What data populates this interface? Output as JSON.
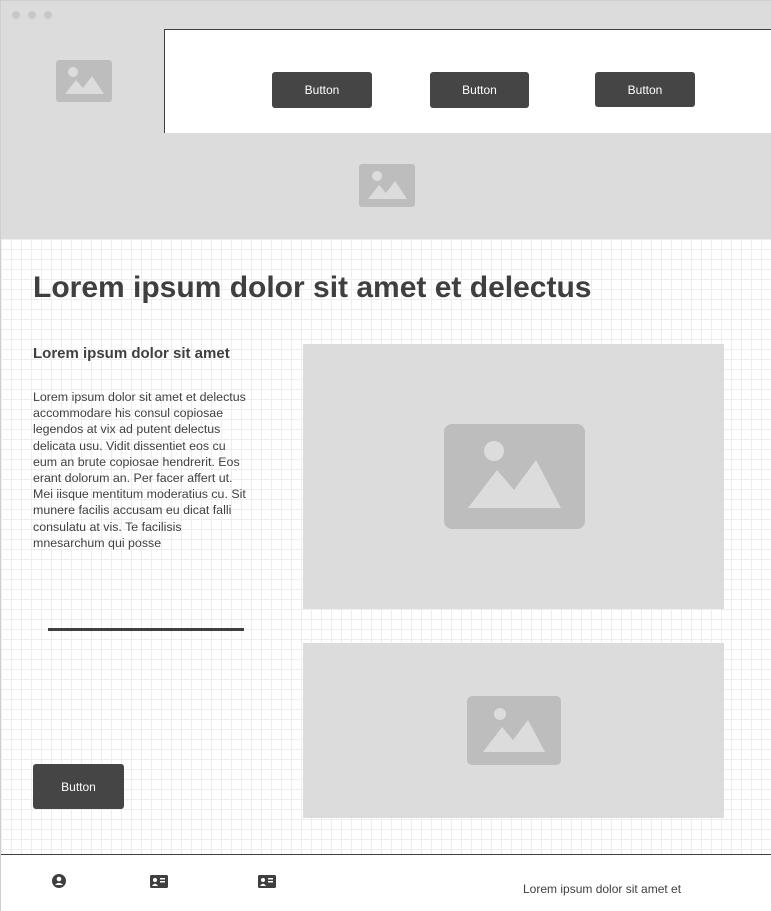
{
  "window": {
    "controls": [
      "dot",
      "dot",
      "dot"
    ]
  },
  "header": {
    "logo_icon": "image-placeholder-icon",
    "nav_buttons": [
      "Button",
      "Button",
      "Button"
    ]
  },
  "hero": {
    "icon": "image-placeholder-icon"
  },
  "main": {
    "headline": "Lorem ipsum dolor sit amet et delectus",
    "subheading": "Lorem ipsum dolor sit amet",
    "paragraph": "Lorem ipsum dolor sit amet et delectus accommodare his consul copiosae legendos at vix ad putent delectus delicata usu. Vidit dissentiet eos cu eum an brute copiosae hendrerit. Eos erant dolorum an. Per facer affert ut. Mei iisque mentitum moderatius cu. Sit munere facilis accusam eu dicat falli consulatu at vis. Te facilisis mnesarchum qui posse",
    "cta_button": "Button",
    "image_top_icon": "image-placeholder-icon",
    "image_bottom_icon": "image-placeholder-icon"
  },
  "footer": {
    "icons": [
      "user-circle-icon",
      "contact-card-icon",
      "contact-card-icon"
    ],
    "text": "Lorem ipsum dolor sit amet et"
  },
  "colors": {
    "dark": "#454545",
    "placeholder_bg": "#dcdcdc",
    "placeholder_icon": "#bdbdbd",
    "text": "#3f3f3f"
  }
}
